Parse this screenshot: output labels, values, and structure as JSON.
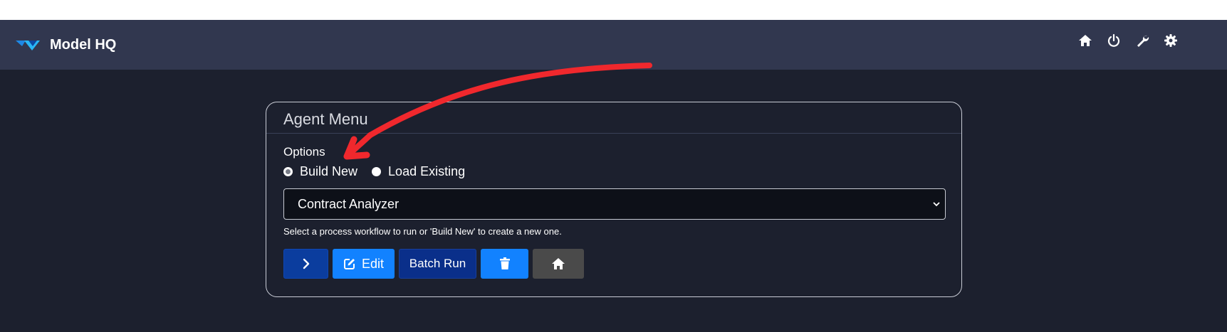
{
  "app": {
    "title": "Model HQ"
  },
  "topbar": {
    "icons": [
      "home-icon",
      "power-icon",
      "wrench-icon",
      "gear-icon"
    ]
  },
  "agent_menu": {
    "title": "Agent Menu",
    "options_label": "Options",
    "radios": [
      {
        "label": "Build New",
        "checked": true
      },
      {
        "label": "Load Existing",
        "checked": false
      }
    ],
    "workflow_select": {
      "value": "Contract Analyzer"
    },
    "help_text": "Select a process workflow to run or 'Build New' to create a new one.",
    "buttons": {
      "run_icon": "chevron-right-icon",
      "edit_label": "Edit",
      "batch_run_label": "Batch Run",
      "delete_icon": "trash-icon",
      "home_icon": "home-icon"
    }
  },
  "annotation": {
    "arrow_color": "#f0282d"
  },
  "colors": {
    "background": "#1c202e",
    "topbar": "#31374f",
    "primary_blue": "#1282ff",
    "dark_blue": "#0a2f8a",
    "gray_button": "#4a4a4a"
  }
}
